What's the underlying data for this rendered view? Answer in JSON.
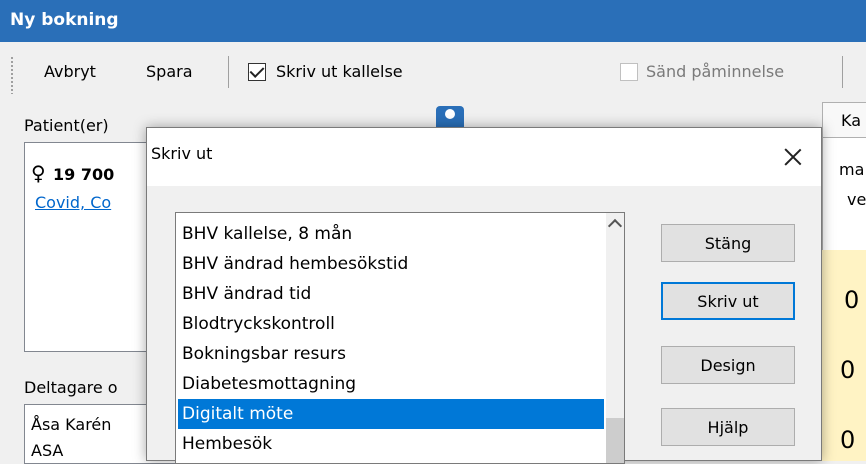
{
  "window": {
    "title": "Ny bokning"
  },
  "toolbar": {
    "cancel_label": "Avbryt",
    "save_label": "Spara",
    "print_notice_label": "Skriv ut kallelse",
    "print_notice_checked": true,
    "send_reminder_label": "Sänd påminnelse",
    "send_reminder_checked": false
  },
  "patient": {
    "heading": "Patient(er)",
    "id_text": "19 700",
    "gender_icon": "female-icon",
    "name_link": "Covid, Co"
  },
  "participants": {
    "heading": "Deltagare o",
    "row1": "Åsa Karén",
    "row2": "ASA"
  },
  "right_panel": {
    "tab_label": "Ka",
    "line1": "ma",
    "line2": "ve",
    "value1": "0",
    "value2": "0",
    "value3": "0"
  },
  "dialog": {
    "title": "Skriv ut",
    "items": [
      "BHV kallelse, 8 mån",
      "BHV ändrad hembesökstid",
      "BHV ändrad tid",
      "Blodtryckskontroll",
      "Bokningsbar resurs",
      "Diabetesmottagning",
      "Digitalt möte",
      "Hembesök"
    ],
    "selected_item": "Digitalt möte",
    "buttons": {
      "close": "Stäng",
      "print": "Skriv ut",
      "design": "Design",
      "help": "Hjälp"
    }
  }
}
